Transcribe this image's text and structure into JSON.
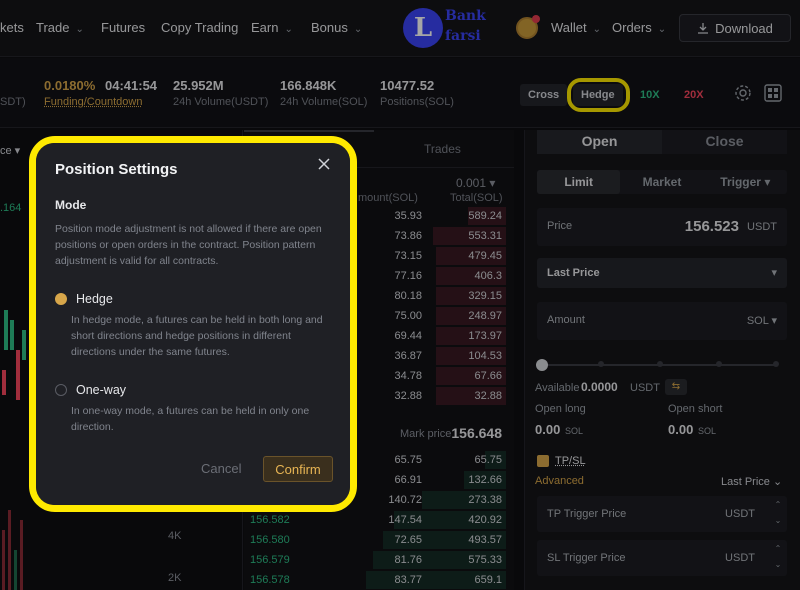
{
  "nav": {
    "items": [
      {
        "label": "kets",
        "caret": false
      },
      {
        "label": "Trade",
        "caret": true
      },
      {
        "label": "Futures",
        "caret": false
      },
      {
        "label": "Copy Trading",
        "caret": false
      },
      {
        "label": "Earn",
        "caret": true
      },
      {
        "label": "Bonus",
        "caret": true
      }
    ],
    "logo_line1": "Bank",
    "logo_line2": "farsi",
    "logo_letter": "L",
    "wallet": "Wallet",
    "orders": "Orders",
    "download": "Download"
  },
  "ticker": {
    "first_label_partial": "SDT)",
    "funding_rate": "0.0180%",
    "countdown": "04:41:54",
    "funding_label": "Funding/Countdown",
    "vol_usdt": "25.952M",
    "vol_usdt_label": "24h Volume(USDT)",
    "vol_sol": "166.848K",
    "vol_sol_label": "24h Volume(SOL)",
    "positions": "10477.52",
    "positions_label": "Positions(SOL)",
    "cross": "Cross",
    "hedge": "Hedge",
    "lev_long": "10X",
    "lev_short": "20X"
  },
  "chart": {
    "partial_top_label": "ce",
    "price_partial": ".164",
    "axis": [
      "4K",
      "2K"
    ]
  },
  "book": {
    "trades_tab": "Trades",
    "precision": "0.001",
    "col_amount": "mount(SOL)",
    "col_total": "Total(SOL)",
    "asks": [
      {
        "amount": "35.93",
        "total": "589.24",
        "fill": 0.27
      },
      {
        "amount": "73.86",
        "total": "553.31",
        "fill": 0.52
      },
      {
        "amount": "73.15",
        "total": "479.45",
        "fill": 0.5
      },
      {
        "amount": "77.16",
        "total": "406.3",
        "fill": 0.5
      },
      {
        "amount": "80.18",
        "total": "329.15",
        "fill": 0.5
      },
      {
        "amount": "75.00",
        "total": "248.97",
        "fill": 0.5
      },
      {
        "amount": "69.44",
        "total": "173.97",
        "fill": 0.5
      },
      {
        "amount": "36.87",
        "total": "104.53",
        "fill": 0.5
      },
      {
        "amount": "34.78",
        "total": "67.66",
        "fill": 0.5
      },
      {
        "amount": "32.88",
        "total": "32.88",
        "fill": 0.5
      }
    ],
    "mark_label": "Mark price",
    "mark_value": "156.648",
    "bids": [
      {
        "price": "",
        "amount": "65.75",
        "total": "65.75",
        "fill": 0.15
      },
      {
        "price": "",
        "amount": "66.91",
        "total": "132.66",
        "fill": 0.3
      },
      {
        "price": "",
        "amount": "140.72",
        "total": "273.38",
        "fill": 0.6
      },
      {
        "price": "156.582",
        "amount": "147.54",
        "total": "420.92",
        "fill": 0.8
      },
      {
        "price": "156.580",
        "amount": "72.65",
        "total": "493.57",
        "fill": 0.88
      },
      {
        "price": "156.579",
        "amount": "81.76",
        "total": "575.33",
        "fill": 0.95
      },
      {
        "price": "156.578",
        "amount": "83.77",
        "total": "659.1",
        "fill": 1.0
      }
    ]
  },
  "panel": {
    "open": "Open",
    "close": "Close",
    "limit": "Limit",
    "market": "Market",
    "trigger": "Trigger",
    "price_label": "Price",
    "price_value": "156.523",
    "price_unit": "USDT",
    "last_price": "Last Price",
    "amount_label": "Amount",
    "amount_unit": "SOL",
    "available_label": "Available",
    "available_value": "0.0000",
    "available_unit": "USDT",
    "open_long": "Open long",
    "open_short": "Open short",
    "long_value": "0.00",
    "short_value": "0.00",
    "sol": "SOL",
    "tpsl": "TP/SL",
    "advanced": "Advanced",
    "last_price_select": "Last Price",
    "tp_trigger": "TP Trigger Price",
    "sl_trigger": "SL Trigger Price",
    "usdt": "USDT"
  },
  "modal": {
    "title": "Position Settings",
    "mode_heading": "Mode",
    "intro": "Position mode adjustment is not allowed if there are open positions or open orders in the contract. Position pattern adjustment is valid for all contracts.",
    "hedge_label": "Hedge",
    "hedge_desc": "In hedge mode, a futures can be held in both long and short directions and hedge positions in different directions under the same futures.",
    "oneway_label": "One-way",
    "oneway_desc": "In one-way mode, a futures can be held in only one direction.",
    "cancel": "Cancel",
    "confirm": "Confirm"
  },
  "colors": {
    "accent": "#d7a64a",
    "buy": "#2ebd85",
    "sell": "#f6465d",
    "highlight": "#ffea00"
  }
}
